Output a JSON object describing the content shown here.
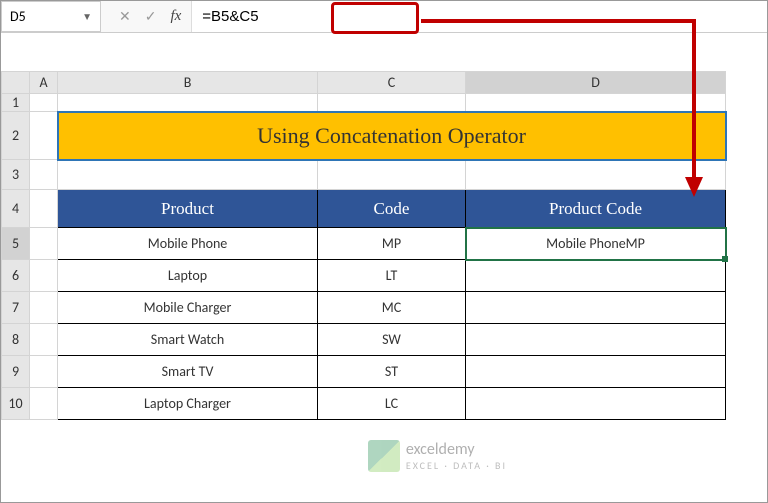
{
  "nameBox": {
    "value": "D5"
  },
  "formulaBar": {
    "formula": "=B5&C5"
  },
  "columns": [
    "A",
    "B",
    "C",
    "D"
  ],
  "title": "Using Concatenation Operator",
  "headers": {
    "product": "Product",
    "code": "Code",
    "productCode": "Product Code"
  },
  "rows": [
    {
      "product": "Mobile Phone",
      "code": "MP",
      "productCode": "Mobile PhoneMP"
    },
    {
      "product": "Laptop",
      "code": "LT",
      "productCode": ""
    },
    {
      "product": "Mobile Charger",
      "code": "MC",
      "productCode": ""
    },
    {
      "product": "Smart Watch",
      "code": "SW",
      "productCode": ""
    },
    {
      "product": "Smart TV",
      "code": "ST",
      "productCode": ""
    },
    {
      "product": "Laptop Charger",
      "code": "LC",
      "productCode": ""
    }
  ],
  "rowNumbers": [
    "1",
    "2",
    "3",
    "4",
    "5",
    "6",
    "7",
    "8",
    "9",
    "10"
  ],
  "watermark": {
    "title": "exceldemy",
    "subtitle": "EXCEL · DATA · BI"
  }
}
